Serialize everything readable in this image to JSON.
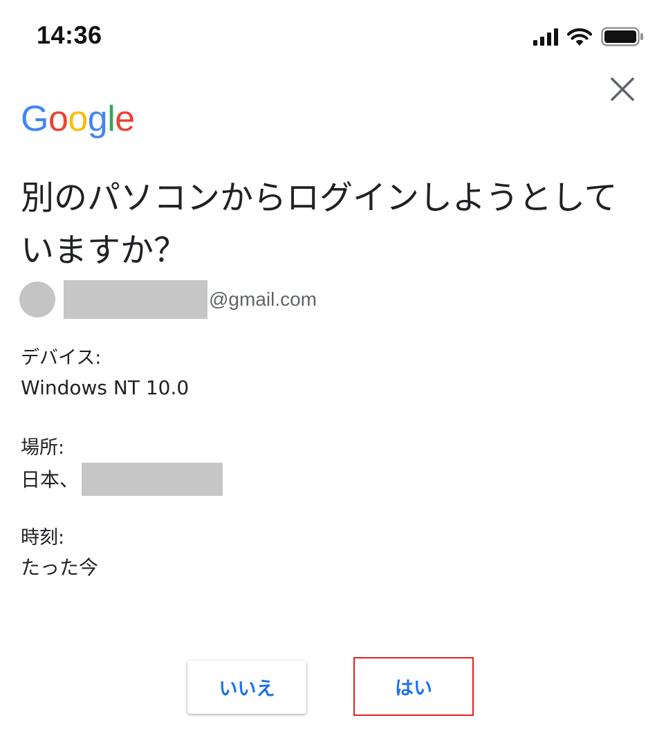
{
  "status_bar": {
    "time": "14:36",
    "icons": [
      "cellular-signal-icon",
      "wifi-icon",
      "battery-icon"
    ]
  },
  "close_icon": "close-icon",
  "logo": {
    "letters": [
      "G",
      "o",
      "o",
      "g",
      "l",
      "e"
    ],
    "colors": [
      "#4285F4",
      "#EA4335",
      "#FBBC05",
      "#4285F4",
      "#34A853",
      "#EA4335"
    ]
  },
  "title": "別のパソコンからログインしようとしていますか？",
  "account": {
    "email_domain": "@gmail.com"
  },
  "details": {
    "device_label": "デバイス:",
    "device_value": "Windows NT 10.0",
    "location_label": "場所:",
    "location_value": "日本、",
    "time_label": "時刻:",
    "time_value": "たった今"
  },
  "buttons": {
    "no_label": "いいえ",
    "yes_label": "はい"
  },
  "colors": {
    "accent": "#1a73e8",
    "highlight": "#e02020",
    "redaction": "#c6c6c6"
  }
}
